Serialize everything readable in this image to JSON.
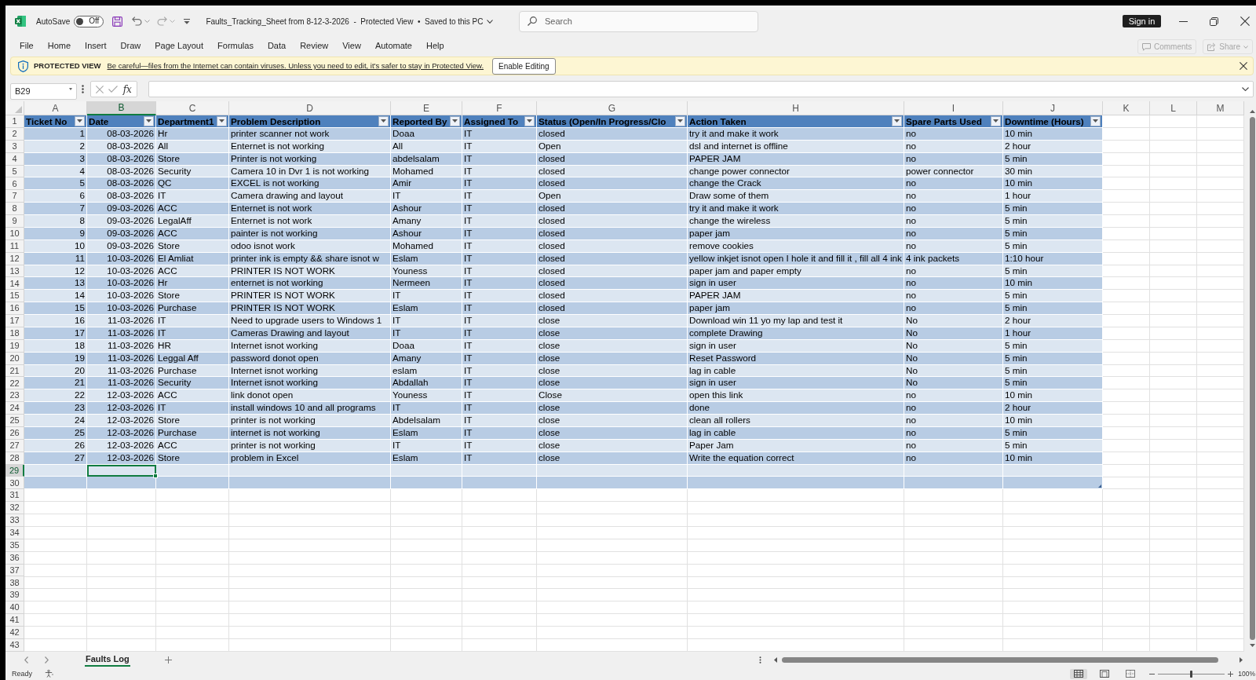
{
  "title_bar": {
    "autosave": {
      "label": "AutoSave",
      "on": false,
      "state_label": "Off"
    },
    "document_title": "Faults_Tracking_Sheet from 8-12-3-2026  -  Protected View  •  Saved to this PC",
    "search": {
      "placeholder": "Search"
    },
    "sign_in": "Sign in"
  },
  "ribbon_tabs": [
    {
      "label": "File",
      "selected": false
    },
    {
      "label": "Home",
      "selected": false
    },
    {
      "label": "Insert",
      "selected": false
    },
    {
      "label": "Draw",
      "selected": false
    },
    {
      "label": "Page Layout",
      "selected": false
    },
    {
      "label": "Formulas",
      "selected": false
    },
    {
      "label": "Data",
      "selected": false
    },
    {
      "label": "Review",
      "selected": false
    },
    {
      "label": "View",
      "selected": false
    },
    {
      "label": "Automate",
      "selected": false
    },
    {
      "label": "Help",
      "selected": false
    }
  ],
  "ribbon_actions": [
    {
      "kind": "comments",
      "label": "Comments",
      "disabled": true
    },
    {
      "kind": "share",
      "label": "Share",
      "disabled": true
    }
  ],
  "message_bar": {
    "title": "PROTECTED VIEW",
    "message": "Be careful—files from the Internet can contain viruses. Unless you need to edit, it's safer to stay in Protected View.",
    "button": "Enable Editing"
  },
  "formula_bar": {
    "name_box": "B29",
    "function_button": "fx"
  },
  "sheet": {
    "column_headers": [
      {
        "label": "A",
        "selected": false
      },
      {
        "label": "B",
        "selected": true
      },
      {
        "label": "C",
        "selected": false
      },
      {
        "label": "D",
        "selected": false
      },
      {
        "label": "E",
        "selected": false
      },
      {
        "label": "F",
        "selected": false
      },
      {
        "label": "G",
        "selected": false
      },
      {
        "label": "H",
        "selected": false
      },
      {
        "label": "I",
        "selected": false
      },
      {
        "label": "J",
        "selected": false
      },
      {
        "label": "K",
        "selected": false
      },
      {
        "label": "L",
        "selected": false
      },
      {
        "label": "M",
        "selected": false
      }
    ],
    "row_headers": [
      {
        "label": "1",
        "selected": false
      },
      {
        "label": "2",
        "selected": false
      },
      {
        "label": "3",
        "selected": false
      },
      {
        "label": "4",
        "selected": false
      },
      {
        "label": "5",
        "selected": false
      },
      {
        "label": "6",
        "selected": false
      },
      {
        "label": "7",
        "selected": false
      },
      {
        "label": "8",
        "selected": false
      },
      {
        "label": "9",
        "selected": false
      },
      {
        "label": "10",
        "selected": false
      },
      {
        "label": "11",
        "selected": false
      },
      {
        "label": "12",
        "selected": false
      },
      {
        "label": "13",
        "selected": false
      },
      {
        "label": "14",
        "selected": false
      },
      {
        "label": "15",
        "selected": false
      },
      {
        "label": "16",
        "selected": false
      },
      {
        "label": "17",
        "selected": false
      },
      {
        "label": "18",
        "selected": false
      },
      {
        "label": "19",
        "selected": false
      },
      {
        "label": "20",
        "selected": false
      },
      {
        "label": "21",
        "selected": false
      },
      {
        "label": "22",
        "selected": false
      },
      {
        "label": "23",
        "selected": false
      },
      {
        "label": "24",
        "selected": false
      },
      {
        "label": "25",
        "selected": false
      },
      {
        "label": "26",
        "selected": false
      },
      {
        "label": "27",
        "selected": false
      },
      {
        "label": "28",
        "selected": false
      },
      {
        "label": "29",
        "selected": true
      },
      {
        "label": "30",
        "selected": false
      },
      {
        "label": "31",
        "selected": false
      },
      {
        "label": "32",
        "selected": false
      },
      {
        "label": "33",
        "selected": false
      },
      {
        "label": "34",
        "selected": false
      },
      {
        "label": "35",
        "selected": false
      },
      {
        "label": "36",
        "selected": false
      },
      {
        "label": "37",
        "selected": false
      },
      {
        "label": "38",
        "selected": false
      },
      {
        "label": "39",
        "selected": false
      },
      {
        "label": "40",
        "selected": false
      },
      {
        "label": "41",
        "selected": false
      },
      {
        "label": "42",
        "selected": false
      },
      {
        "label": "43",
        "selected": false
      }
    ],
    "table": {
      "columns": [
        {
          "label": "Ticket No",
          "kind": "number"
        },
        {
          "label": "Date",
          "kind": "date"
        },
        {
          "label": "Department1",
          "kind": "text"
        },
        {
          "label": "Problem Description",
          "kind": "text"
        },
        {
          "label": "Reported By",
          "kind": "text"
        },
        {
          "label": "Assigned To",
          "kind": "text"
        },
        {
          "label": "Status (Open/In Progress/Clo",
          "kind": "text"
        },
        {
          "label": "Action Taken",
          "kind": "text"
        },
        {
          "label": "Spare Parts Used",
          "kind": "text"
        },
        {
          "label": "Downtime (Hours)",
          "kind": "text"
        }
      ],
      "rows": [
        [
          "1",
          "08-03-2026",
          "Hr",
          "printer scanner not work",
          "Doaa",
          "IT",
          "closed",
          "try it and make it work",
          "no",
          "10 min"
        ],
        [
          "2",
          "08-03-2026",
          "All",
          "Enternet is not working",
          "All",
          "IT",
          "Open",
          "dsl and internet is offline",
          "no",
          "2 hour"
        ],
        [
          "3",
          "08-03-2026",
          "Store",
          "Printer is not working",
          "abdelsalam",
          "IT",
          "closed",
          "PAPER JAM",
          "no",
          "5 min"
        ],
        [
          "4",
          "08-03-2026",
          "Security",
          "Camera 10 in Dvr 1 is not working",
          "Mohamed",
          "IT",
          "closed",
          "change power connector",
          "power connector",
          "30 min"
        ],
        [
          "5",
          "08-03-2026",
          "QC",
          "EXCEL is not working",
          "Amir",
          "IT",
          "closed",
          "change the Crack",
          "no",
          "10 min"
        ],
        [
          "6",
          "08-03-2026",
          "IT",
          "Camera drawing and layout",
          "IT",
          "IT",
          "Open",
          "Draw some of them",
          "no",
          "1 hour"
        ],
        [
          "7",
          "09-03-2026",
          "ACC",
          "Enternet is not work",
          "Ashour",
          "IT",
          "closed",
          "try it and make it work",
          "no",
          "5 min"
        ],
        [
          "8",
          "09-03-2026",
          "LegalAff",
          "Enternet is not work",
          "Amany",
          "IT",
          "closed",
          "change the wireless",
          "no",
          "5 min"
        ],
        [
          "9",
          "09-03-2026",
          "ACC",
          "painter is not working",
          "Ashour",
          "IT",
          "closed",
          "paper jam",
          "no",
          "5 min"
        ],
        [
          "10",
          "09-03-2026",
          "Store",
          "odoo isnot work",
          "Mohamed",
          "IT",
          "closed",
          "remove cookies",
          "no",
          "5 min"
        ],
        [
          "11",
          "10-03-2026",
          "El Amliat",
          "printer ink is empty && share isnot w",
          "Eslam",
          "IT",
          "closed",
          "yellow inkjet isnot open I hole it and fill it , fill all 4 ink",
          "4 ink packets",
          "1:10 hour"
        ],
        [
          "12",
          "10-03-2026",
          "ACC",
          "PRINTER IS NOT WORK",
          "Youness",
          "IT",
          "closed",
          "paper jam and paper empty",
          "no",
          "5 min"
        ],
        [
          "13",
          "10-03-2026",
          "Hr",
          "enternet is not working",
          "Nermeen",
          "IT",
          "closed",
          "sign in user",
          "no",
          "10 min"
        ],
        [
          "14",
          "10-03-2026",
          "Store",
          "PRINTER IS NOT WORK",
          "IT",
          "IT",
          "closed",
          "PAPER JAM",
          "no",
          "5 min"
        ],
        [
          "15",
          "10-03-2026",
          "Purchase",
          "PRINTER IS NOT WORK",
          "Eslam",
          "IT",
          "closed",
          "paper jam",
          "no",
          "5 min"
        ],
        [
          "16",
          "11-03-2026",
          "IT",
          "Need to upgrade users to Windows 1",
          "IT",
          "IT",
          "close",
          "Download win 11 yo my lap and test it",
          "No",
          "2 hour"
        ],
        [
          "17",
          "11-03-2026",
          "IT",
          "Cameras Drawing and layout",
          "IT",
          "IT",
          "close",
          "complete Drawing",
          "No",
          "1 hour"
        ],
        [
          "18",
          "11-03-2026",
          "HR",
          "Internet isnot working",
          "Doaa",
          "IT",
          "close",
          "sign in user",
          "No",
          "5 min"
        ],
        [
          "19",
          "11-03-2026",
          "Leggal Aff",
          "password donot open",
          "Amany",
          "IT",
          "close",
          "Reset Password",
          "No",
          "5 min"
        ],
        [
          "20",
          "11-03-2026",
          "Purchase",
          "Internet isnot working",
          "eslam",
          "IT",
          "close",
          "lag in cable",
          "No",
          "5 min"
        ],
        [
          "21",
          "11-03-2026",
          "Security",
          "Internet isnot working",
          "Abdallah",
          "IT",
          "close",
          "sign in user",
          "No",
          "5 min"
        ],
        [
          "22",
          "12-03-2026",
          "ACC",
          "link donot open",
          "Youness",
          "IT",
          "Close",
          "open this link",
          "no",
          "10 min"
        ],
        [
          "23",
          "12-03-2026",
          "IT",
          "install windows 10 and all programs",
          "IT",
          "IT",
          "close",
          "done",
          "no",
          "2 hour"
        ],
        [
          "24",
          "12-03-2026",
          "Store",
          "printer is not working",
          "Abdelsalam",
          "IT",
          "close",
          "clean all rollers",
          "no",
          "10 min"
        ],
        [
          "25",
          "12-03-2026",
          "Purchase",
          "internet is not working",
          "Eslam",
          "IT",
          "close",
          "lag in cable",
          "no",
          "5 min"
        ],
        [
          "26",
          "12-03-2026",
          "ACC",
          "printer is not working",
          "IT",
          "IT",
          "close",
          "Paper Jam",
          "no",
          "5 min"
        ],
        [
          "27",
          "12-03-2026",
          "Store",
          "problem in Excel",
          "Eslam",
          "IT",
          "close",
          "Write the equation correct",
          "no",
          "10 min"
        ]
      ]
    }
  },
  "sheet_tabs": [
    {
      "label": "Faults Log",
      "selected": true
    }
  ],
  "status_bar": {
    "status": "Ready",
    "views": [
      {
        "kind": "normal",
        "selected": true
      },
      {
        "kind": "page_layout",
        "selected": false
      },
      {
        "kind": "page_break",
        "selected": false
      }
    ],
    "zoom": {
      "level": 0.5,
      "reading": "100%"
    }
  }
}
